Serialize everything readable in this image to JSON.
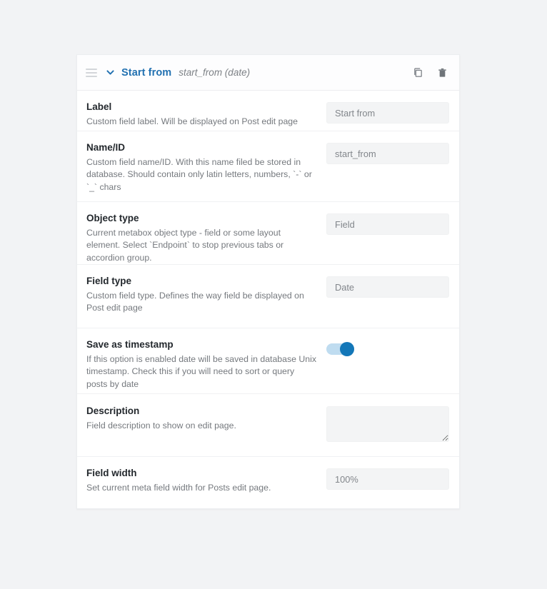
{
  "header": {
    "title": "Start from",
    "slug": "start_from (date)",
    "drag_handle_icon": "drag-handle-icon",
    "collapse_icon": "chevron-down-icon",
    "duplicate_icon": "copy-icon",
    "delete_icon": "trash-icon",
    "accent_color": "#2271b1"
  },
  "rows": {
    "label": {
      "label": "Label",
      "description": "Custom field label. Will be displayed on Post edit page",
      "value": "Start from"
    },
    "name_id": {
      "label": "Name/ID",
      "description": "Custom field name/ID. With this name filed be stored in database. Should contain only latin letters, numbers, `-` or `_` chars",
      "value": "start_from"
    },
    "object_type": {
      "label": "Object type",
      "description": "Current metabox object type - field or some layout element. Select `Endpoint` to stop previous tabs or accordion group.",
      "value": "Field"
    },
    "field_type": {
      "label": "Field type",
      "description": "Custom field type. Defines the way field be displayed on Post edit page",
      "value": "Date"
    },
    "save_as_timestamp": {
      "label": "Save as timestamp",
      "description": "If this option is enabled date will be saved in database Unix timestamp. Check this if you will need to sort or query posts by date",
      "toggle_state": "on",
      "toggle_on_color": "#1377b8",
      "toggle_track_color": "#bfdcf0"
    },
    "description": {
      "label": "Description",
      "description": "Field description to show on edit page.",
      "value": ""
    },
    "field_width": {
      "label": "Field width",
      "description": "Set current meta field width for Posts edit page.",
      "value": "100%"
    }
  }
}
